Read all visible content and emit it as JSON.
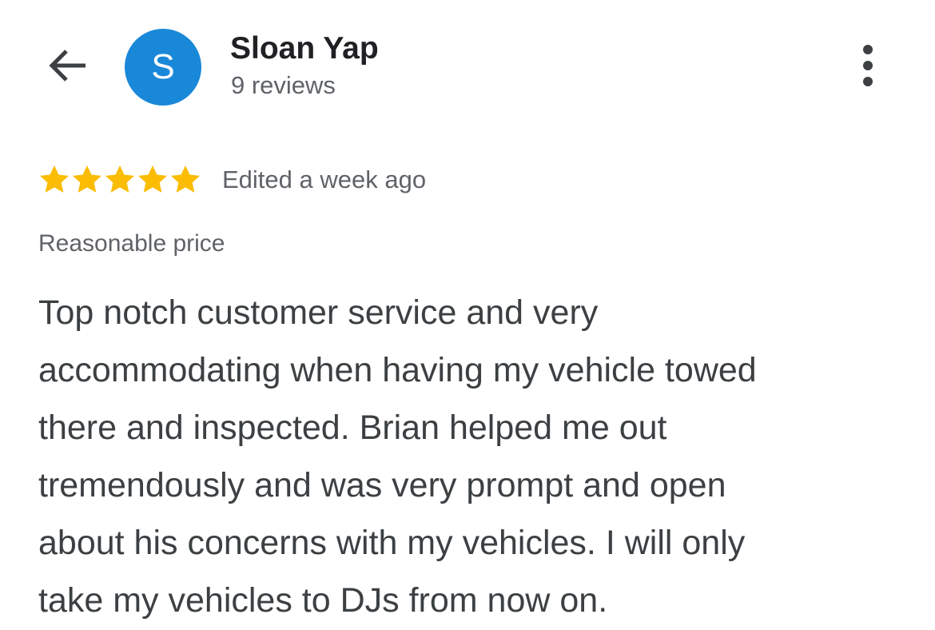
{
  "header": {
    "back_icon": "arrow-back-icon",
    "avatar_letter": "S",
    "avatar_color": "#1a88d9",
    "reviewer_name": "Sloan Yap",
    "review_count": "9 reviews",
    "more_icon": "more-vertical-icon"
  },
  "review": {
    "rating": 5,
    "rating_max": 5,
    "star_color": "#fbbc04",
    "edited_label": "Edited a week ago",
    "tag": "Reasonable price",
    "lines": [
      "Top notch customer service and very",
      "accommodating when having my vehicle towed",
      "there and inspected. Brian helped me out",
      "tremendously and was very prompt and open",
      "about his concerns with my vehicles. I will only",
      "take my vehicles to DJs from now on."
    ]
  }
}
